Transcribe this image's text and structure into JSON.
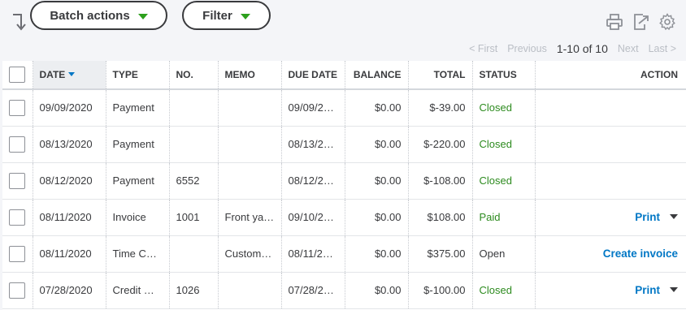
{
  "toolbar": {
    "batch_label": "Batch actions",
    "filter_label": "Filter",
    "accent_color": "#2ca01c"
  },
  "pagination": {
    "first": "< First",
    "previous": "Previous",
    "range": "1-10 of 10",
    "next": "Next",
    "last": "Last >"
  },
  "table": {
    "headers": {
      "date": "DATE",
      "type": "TYPE",
      "no": "NO.",
      "memo": "MEMO",
      "due_date": "DUE DATE",
      "balance": "BALANCE",
      "total": "TOTAL",
      "status": "STATUS",
      "action": "ACTION"
    },
    "rows": [
      {
        "date": "09/09/2020",
        "type": "Payment",
        "no": "",
        "memo": "",
        "due_date": "09/09/2…",
        "balance": "$0.00",
        "total": "$-39.00",
        "status": "Closed",
        "action": ""
      },
      {
        "date": "08/13/2020",
        "type": "Payment",
        "no": "",
        "memo": "",
        "due_date": "08/13/2…",
        "balance": "$0.00",
        "total": "$-220.00",
        "status": "Closed",
        "action": ""
      },
      {
        "date": "08/12/2020",
        "type": "Payment",
        "no": "6552",
        "memo": "",
        "due_date": "08/12/2…",
        "balance": "$0.00",
        "total": "$-108.00",
        "status": "Closed",
        "action": ""
      },
      {
        "date": "08/11/2020",
        "type": "Invoice",
        "no": "1001",
        "memo": "Front ya…",
        "due_date": "09/10/2…",
        "balance": "$0.00",
        "total": "$108.00",
        "status": "Paid",
        "action": "Print"
      },
      {
        "date": "08/11/2020",
        "type": "Time C…",
        "no": "",
        "memo": "Custom…",
        "due_date": "08/11/2…",
        "balance": "$0.00",
        "total": "$375.00",
        "status": "Open",
        "action": "Create invoice"
      },
      {
        "date": "07/28/2020",
        "type": "Credit …",
        "no": "1026",
        "memo": "",
        "due_date": "07/28/2…",
        "balance": "$0.00",
        "total": "$-100.00",
        "status": "Closed",
        "action": "Print"
      }
    ]
  }
}
